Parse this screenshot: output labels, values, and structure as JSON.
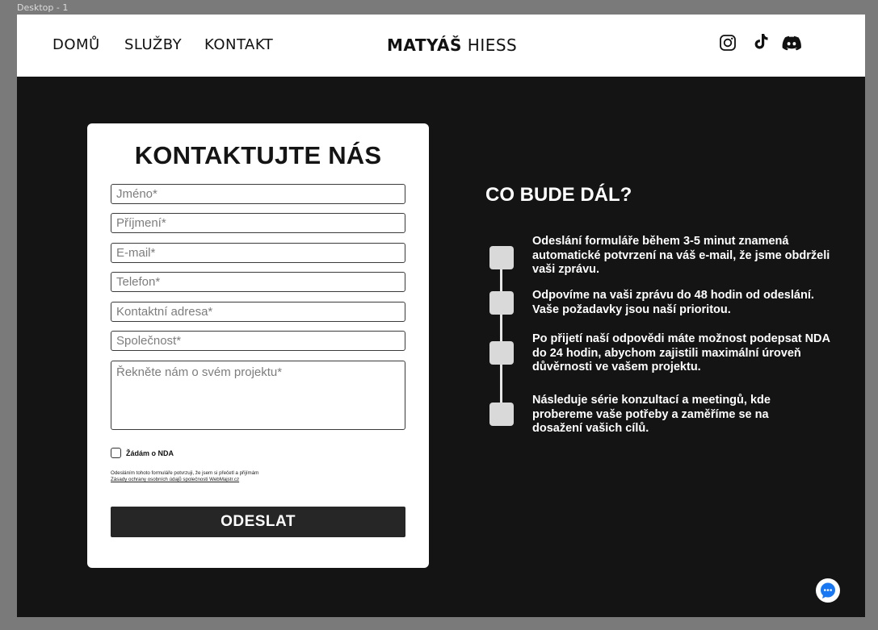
{
  "canvas": {
    "frame_label": "Desktop - 1"
  },
  "nav": {
    "home": "DOMŮ",
    "services": "SLUŽBY",
    "contact": "KONTAKT"
  },
  "brand": {
    "first": "MATYÁŠ",
    "last": "HIESS"
  },
  "social": [
    "instagram-icon",
    "tiktok-icon",
    "discord-icon"
  ],
  "form": {
    "title": "KONTAKTUJTE NÁS",
    "first_name_placeholder": "Jméno*",
    "last_name_placeholder": "Příjmení*",
    "email_placeholder": "E-mail*",
    "phone_placeholder": "Telefon*",
    "address_placeholder": "Kontaktní adresa*",
    "company_placeholder": "Společnost*",
    "project_placeholder": "Řekněte nám o svém projektu*",
    "nda_label": "Žádám o NDA",
    "legal_line1": "Odesláním tohoto formuláře potvrzuji, že jsem si přečetl a přijímám",
    "legal_line2": "Zásady ochrany osobních údajů společnosti WebMajstr.cz",
    "submit": "ODESLAT"
  },
  "next_steps": {
    "title": "CO BUDE DÁL?",
    "steps": [
      "Odeslání formuláře během 3-5 minut znamená automatické potvrzení na váš e-mail, že jsme obdrželi vaši zprávu.",
      "Odpovíme na vaši zprávu do 48 hodin od odeslání. Vaše požadavky jsou naší prioritou.",
      "Po přijetí naší odpovědi máte možnost podepsat NDA do 24 hodin, abychom zajistili maximální úroveň důvěrnosti ve vašem projektu.",
      "Následuje série konzultací a meetingů, kde probereme vaše potřeby a zaměříme se na dosažení vašich cílů."
    ]
  },
  "colors": {
    "page_bg": "#141414",
    "header_bg": "#ffffff",
    "button_bg": "#262626",
    "chat_accent": "#1877f2"
  }
}
